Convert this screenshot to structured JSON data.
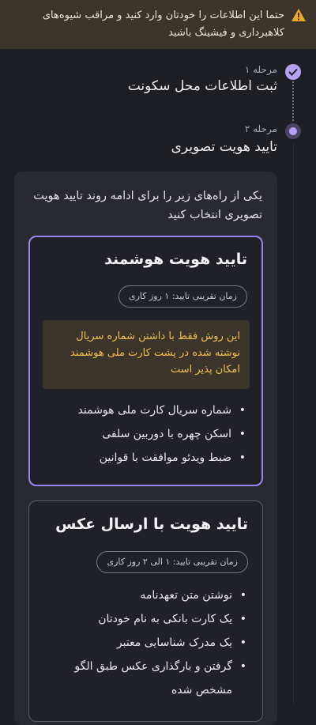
{
  "warning": {
    "icon": "warning-icon",
    "text": "حتما این اطلاعات را خودتان وارد کنید و مراقب شیوه‌های کلاهبرداری و فیشینگ باشید",
    "bg": "#3a342a",
    "icon_color": "#f5a623"
  },
  "stepper": {
    "steps": [
      {
        "label": "مرحله ۱",
        "title": "ثبت اطلاعات محل سکونت",
        "status": "completed"
      },
      {
        "label": "مرحله ۲",
        "title": "تایید هویت تصویری",
        "status": "current"
      }
    ],
    "accent": "#b7a2f5"
  },
  "main": {
    "intro": "یکی از راه‌های زیر را برای ادامه روند تایید هویت تصویری انتخاب کنید",
    "options": [
      {
        "title": "تایید هویت هوشمند",
        "time": "زمان تقریبی تایید: ۱ روز کاری",
        "note": "این روش فقط با داشتن شماره سریال نوشته شده در پشت کارت ملی هوشمند امکان پذیر است",
        "features": [
          "شماره سریال کارت ملی هوشمند",
          "اسکن چهره با دوربین سلفی",
          "ضبط ویدئو موافقت با قوانین"
        ],
        "selected": true
      },
      {
        "title": "تایید هویت با ارسال عکس",
        "time": "زمان تقریبی تایید: ۱ الی ۲ روز کاری",
        "features": [
          "نوشتن متن تعهدنامه",
          "یک کارت بانکی به نام خودتان",
          "یک مدرک شناسایی معتبر",
          "گرفتن و بارگذاری عکس طبق الگو مشخص شده"
        ],
        "selected": false
      }
    ]
  }
}
